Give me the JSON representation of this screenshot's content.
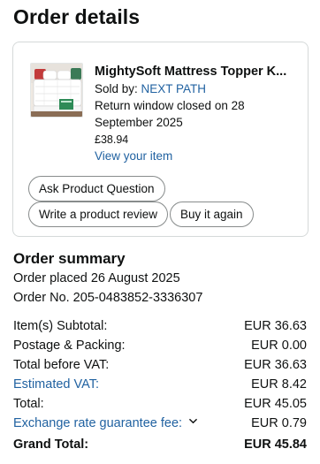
{
  "header": {
    "title": "Order details"
  },
  "item": {
    "title": "MightySoft Mattress Topper K...",
    "sold_by_prefix": "Sold by: ",
    "seller": "NEXT PATH",
    "return_line_1": "Return window closed on 28",
    "return_line_2": "September 2025",
    "price": "£38.94",
    "view_link": "View your item",
    "image_icon": "mattress-topper-product-image"
  },
  "actions": {
    "ask": "Ask Product Question",
    "review": "Write a product review",
    "buy_again": "Buy it again"
  },
  "summary": {
    "title": "Order summary",
    "placed": "Order placed 26 August 2025",
    "order_no": "Order No. 205-0483852-3336307",
    "rows": [
      {
        "label": "Item(s) Subtotal:",
        "value": "EUR 36.63"
      },
      {
        "label": "Postage & Packing:",
        "value": "EUR 0.00"
      },
      {
        "label": "Total before VAT:",
        "value": "EUR 36.63"
      },
      {
        "label": "Estimated VAT:",
        "value": "EUR 8.42"
      },
      {
        "label": "Total:",
        "value": "EUR 45.05"
      },
      {
        "label": "Exchange rate guarantee fee:",
        "value": "EUR 0.79"
      }
    ],
    "grand_total": {
      "label": "Grand Total:",
      "value": "EUR 45.84"
    }
  },
  "colors": {
    "link": "#2162a1",
    "text": "#0f1111",
    "border": "#d5d9d9"
  }
}
